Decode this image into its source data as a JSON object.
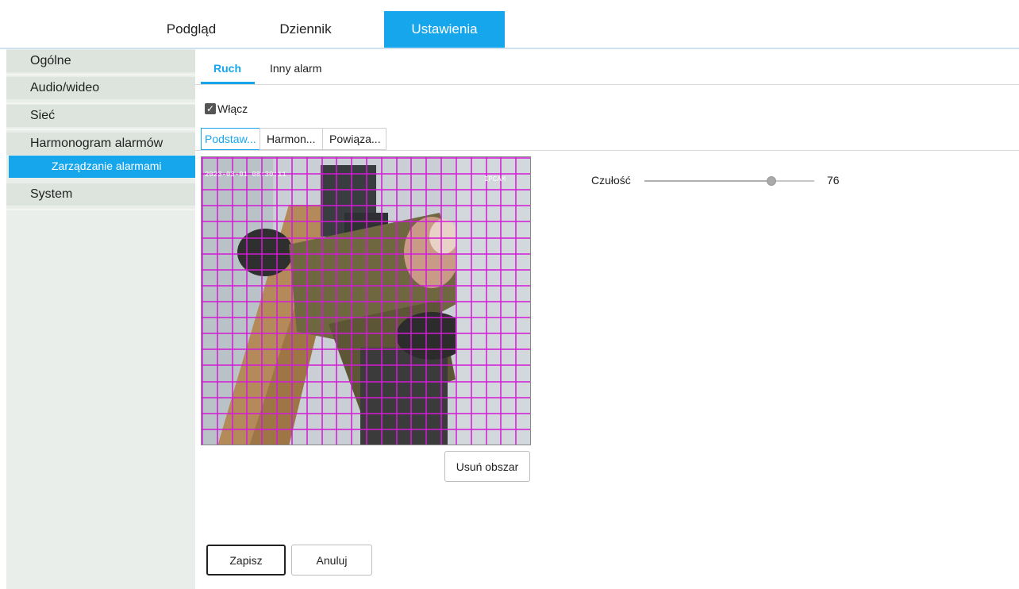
{
  "topnav": {
    "tabs": [
      {
        "label": "Podgląd"
      },
      {
        "label": "Dziennik"
      },
      {
        "label": "Ustawienia"
      }
    ],
    "active_tab": "Ustawienia",
    "accent_color": "#16a6ec"
  },
  "sidebar": {
    "items": [
      {
        "label": "Ogólne"
      },
      {
        "label": "Audio/wideo"
      },
      {
        "label": "Sieć"
      },
      {
        "label": "Harmonogram alarmów"
      },
      {
        "label": "Zarządzanie alarmami"
      },
      {
        "label": "System"
      }
    ],
    "active_item": "Zarządzanie alarmami"
  },
  "subtabs": {
    "items": [
      {
        "label": "Ruch"
      },
      {
        "label": "Inny alarm"
      }
    ],
    "active": "Ruch"
  },
  "enable": {
    "label": "Włącz",
    "checked": true
  },
  "steps": {
    "items": [
      {
        "label": "Podstaw..."
      },
      {
        "label": "Harmon..."
      },
      {
        "label": "Powiąza..."
      }
    ],
    "active": "Podstaw..."
  },
  "video": {
    "timestamp": "2023-03-01 08:30:11",
    "camera_label": "IPCAM",
    "grid_color": "#d31ad6",
    "grid_columns": 22,
    "grid_rows": 18
  },
  "sensitivity": {
    "label": "Czułość",
    "value": 76,
    "min": 0,
    "max": 100,
    "display": "76"
  },
  "buttons": {
    "clear_area": "Usuń obszar",
    "save": "Zapisz",
    "cancel": "Anuluj"
  }
}
